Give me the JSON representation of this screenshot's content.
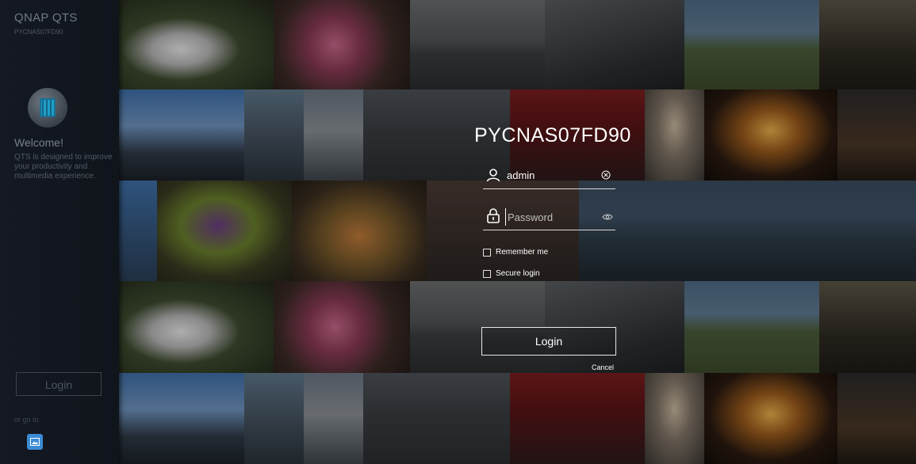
{
  "sidebar": {
    "brand": "QNAP QTS",
    "device": "PYCNAS07FD90",
    "welcome_title": "Welcome!",
    "welcome_text": "QTS is designed to improve your productivity and multimedia experience.",
    "login_label": "Login",
    "go_to_label": "or go to",
    "app_icon": "nas-icon",
    "shortcut_icon": "photo-station-icon"
  },
  "login": {
    "hostname": "PYCNAS07FD90",
    "username": "admin",
    "password_placeholder": "Password",
    "remember_label": "Remember me",
    "secure_label": "Secure login",
    "login_label": "Login",
    "cancel_label": "Cancel",
    "remember_checked": false,
    "secure_checked": false
  },
  "icons": {
    "user": "user-icon",
    "lock": "lock-icon",
    "clear": "clear-icon",
    "show_password": "eye-icon"
  },
  "colors": {
    "sidebar_bg": "#141922",
    "accent_blue": "#3b8bd5",
    "text_white": "#ffffff"
  }
}
